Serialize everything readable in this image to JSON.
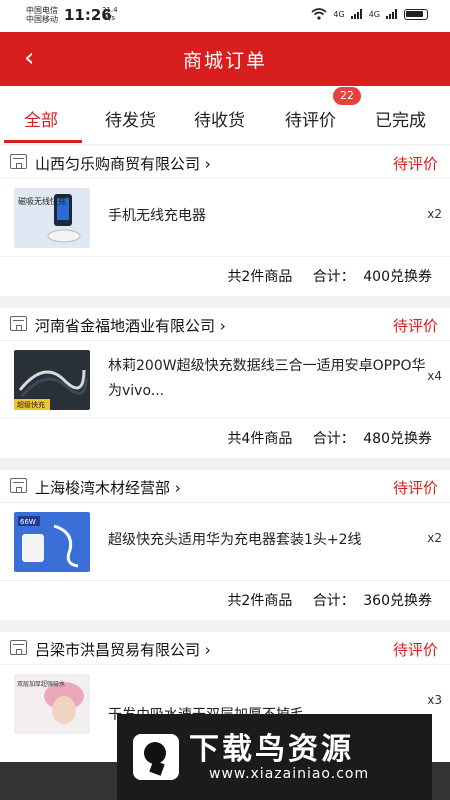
{
  "status_bar": {
    "carrier_1": "中国电信",
    "carrier_2": "中国移动",
    "time": "11:26",
    "net_speed_value": "31.4",
    "net_speed_unit": "K/s",
    "signal_1": "4G",
    "signal_2": "4G"
  },
  "header": {
    "back_glyph": "‹",
    "title": "商城订单"
  },
  "tabs": [
    {
      "label": "全部",
      "active": true
    },
    {
      "label": "待发货"
    },
    {
      "label": "待收货"
    },
    {
      "label": "待评价",
      "badge": "22"
    },
    {
      "label": "已完成"
    }
  ],
  "orders": [
    {
      "shop": "山西匀乐购商贸有限公司",
      "status": "待评价",
      "thumb_caption": "磁吸无线快充",
      "item": "手机无线充电器",
      "qty": "x2",
      "summary_count": "共2件商品",
      "summary_label": "合计：",
      "summary_value": "400兑换券"
    },
    {
      "shop": "河南省金福地酒业有限公司",
      "status": "待评价",
      "thumb_caption": "超级快充",
      "item": "林莉200W超级快充数据线三合一适用安卓OPPO华为vivo...",
      "qty": "x4",
      "summary_count": "共4件商品",
      "summary_label": "合计：",
      "summary_value": "480兑换券"
    },
    {
      "shop": "上海梭湾木材经营部",
      "status": "待评价",
      "thumb_caption": "66W",
      "item": "超级快充头适用华为充电器套装1头+2线",
      "qty": "x2",
      "summary_count": "共2件商品",
      "summary_label": "合计：",
      "summary_value": "360兑换券"
    },
    {
      "shop": "吕梁市洪昌贸易有限公司",
      "status": "待评价",
      "thumb_caption": "双层加厚超强吸水",
      "item": "干发巾吸水速干双层加厚不掉毛",
      "qty": "x3"
    }
  ],
  "watermark": {
    "title": "下载鸟资源",
    "url": "www.xiazainiao.com"
  },
  "colors": {
    "brand_red": "#d81e1e",
    "badge_red": "#e8403a",
    "page_bg": "#f2f2f2"
  }
}
